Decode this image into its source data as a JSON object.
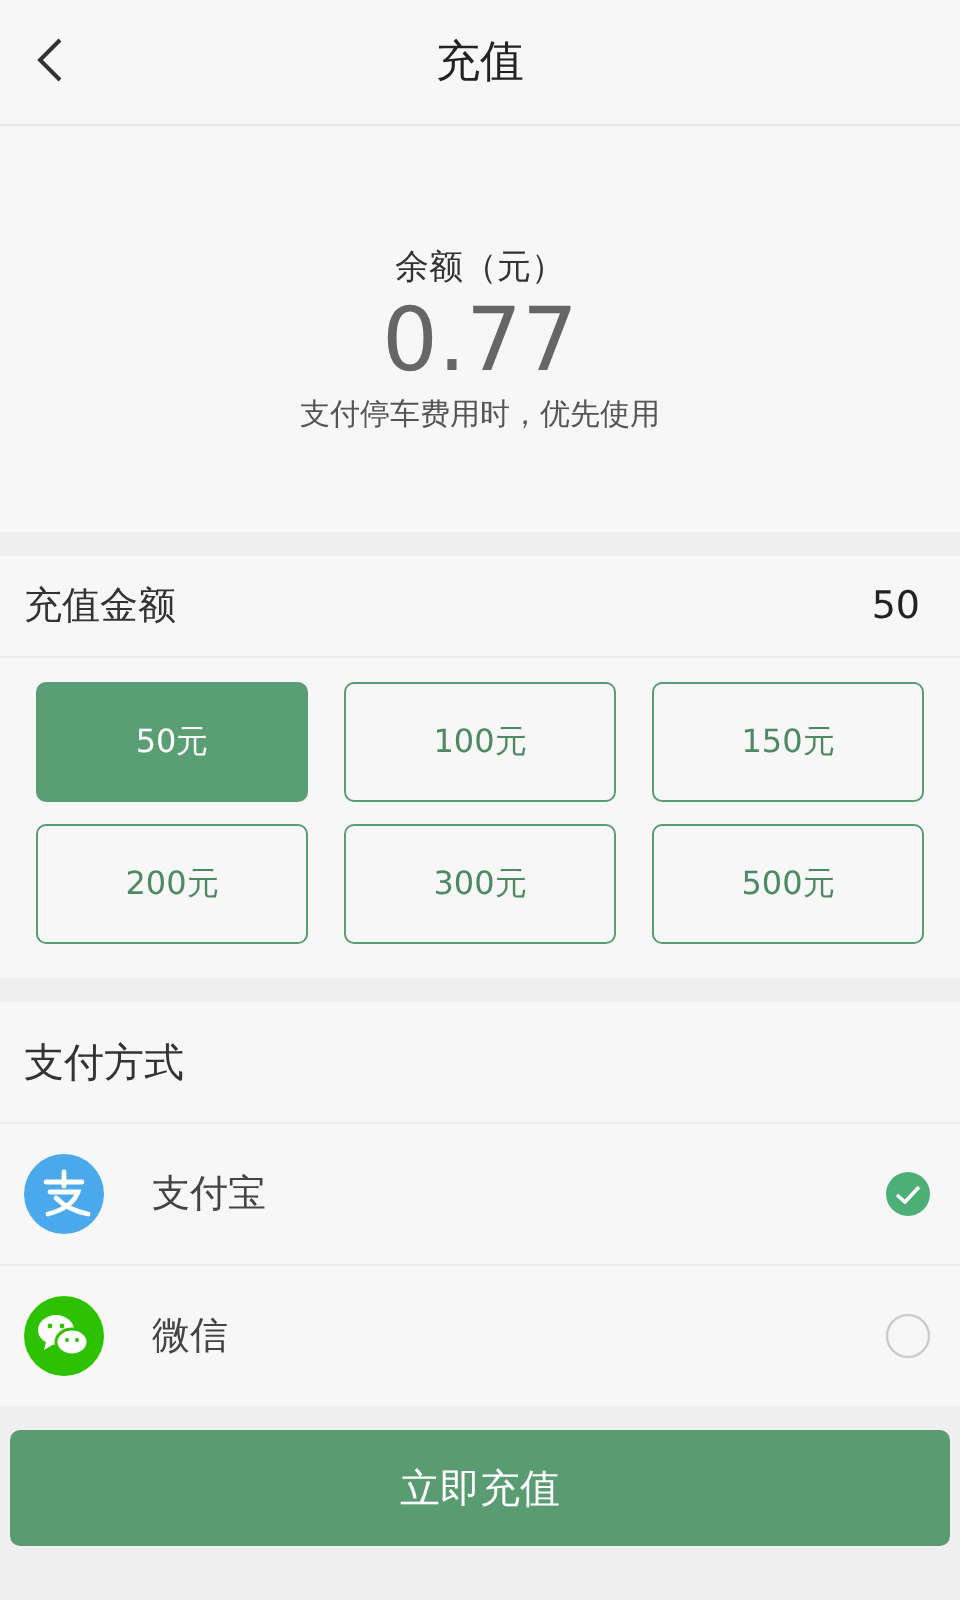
{
  "header": {
    "title": "充值"
  },
  "balance": {
    "label": "余额（元）",
    "amount": "0.77",
    "note": "支付停车费用时，优先使用"
  },
  "recharge": {
    "label": "充值金额",
    "value": "50",
    "options": [
      {
        "label": "50元",
        "selected": true
      },
      {
        "label": "100元",
        "selected": false
      },
      {
        "label": "150元",
        "selected": false
      },
      {
        "label": "200元",
        "selected": false
      },
      {
        "label": "300元",
        "selected": false
      },
      {
        "label": "500元",
        "selected": false
      }
    ]
  },
  "payment": {
    "title": "支付方式",
    "methods": [
      {
        "kind": "alipay",
        "label": "支付宝",
        "selected": true
      },
      {
        "kind": "wechat",
        "label": "微信",
        "selected": false
      }
    ]
  },
  "submit": "立即充值"
}
